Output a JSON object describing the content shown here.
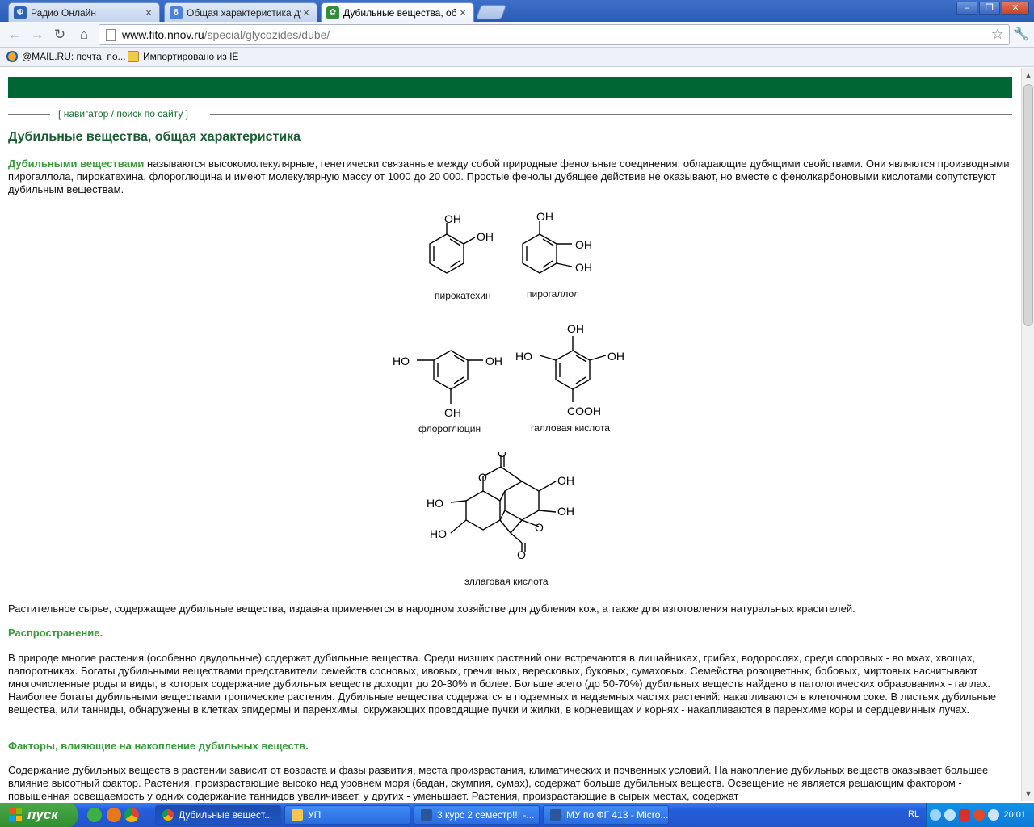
{
  "tabs": [
    {
      "title": "Радио Онлайн",
      "favicon": "Ф",
      "color": "#2b63b8"
    },
    {
      "title": "Общая характеристика ду",
      "favicon": "8",
      "color": "#4b7fe0"
    },
    {
      "title": "Дубильные вещества, общ",
      "favicon": "✿",
      "color": "#2f8f3a"
    }
  ],
  "url": {
    "host": "www.fito.nnov.ru",
    "path": "/special/glycozides/dube/"
  },
  "bookmarks": [
    {
      "label": "@MAIL.RU: почта, по..."
    },
    {
      "label": "Импортировано из IE"
    }
  ],
  "page": {
    "nav": {
      "open": "[",
      "navigator": "навигатор",
      "sep": "/",
      "search": "поиск по сайту",
      "close": "]"
    },
    "title": "Дубильные вещества, общая характеристика",
    "intro_highlight": "Дубильными веществами",
    "intro_text": " называются высокомолекулярные, генетически связанные между собой природные фенольные соединения, обладающие дубящими свойствами. Они являются производными пирогаллола, пирокатехина, флороглюцина и имеют молекулярную массу от 1000 до 20 000. Простые фенолы дубящее действие не оказывают, но вместе с фенолкарбоновыми кислотами сопутствуют дубильным веществам.",
    "chemicals": {
      "pyrocatechol": "пирокатехин",
      "pyrogallol": "пирогаллол",
      "phloroglucinol": "флороглюцин",
      "gallic": "галловая кислота",
      "ellagic": "эллаговая кислота"
    },
    "groups": {
      "oh": "OH",
      "ho": "HO",
      "cooh": "COOH",
      "o": "O"
    },
    "para_raw": "Растительное сырье, содержащее дубильные вещества, издавна применяется в народном хозяйстве для дубления кож, а также для изготовления натуральных красителей.",
    "sec_distribution": "Распространение.",
    "para_distribution": "В природе многие растения (особенно двудольные) содержат дубильные вещества. Среди низших растений они встречаются в лишайниках, грибах, водорослях, среди споровых - во мхах, хвощах, папоротниках. Богаты дубильными веществами представители семейств сосновых, ивовых, гречишных, вересковых, буковых, сумаховых. Семейства розоцветных, бобовых, миртовых насчитывают многочисленные роды и виды, в которых содержание дубильных веществ доходит до 20-30% и более. Больше всего (до 50-70%) дубильных веществ найдено в патологических образованиях - галлах. Наиболее богаты дубильными веществами тропические растения. Дубильные вещества содержатся в подземных и надземных частях растений: накапливаются в клеточном соке. В листьях дубильные вещества, или танниды, обнаружены в клетках эпидермы и паренхимы, окружающих проводящие пучки и жилки, в корневищах и корнях - накапливаются в паренхиме коры и сердцевинных лучах.",
    "sec_factors": "Факторы, влияющие на накопление дубильных веществ.",
    "para_factors": "Содержание дубильных веществ в растении зависит от возраста и фазы развития, места произрастания, климатических и почвенных условий. На накопление дубильных веществ оказывает большее влияние высотный фактор. Растения, произрастающие высоко над уровнем моря (бадан, скумпия, сумах), содержат больше дубильных веществ. Освещение не является решающим фактором - повышенная освещаемость у одних содержание таннидов увеличивает, у других - уменьшает. Растения, произрастающие в сырых местах, содержат"
  },
  "taskbar": {
    "start": "пуск",
    "tasks": [
      "Дубильные вещест...",
      "УП",
      "3 курс 2 семестр!!! -...",
      "МУ по ФГ 413 - Micro..."
    ],
    "lang": "RL",
    "clock": "20:01"
  },
  "colors": {
    "site_green": "#006634",
    "heading_green": "#1a5e34",
    "accent_green": "#3a9a3a"
  }
}
